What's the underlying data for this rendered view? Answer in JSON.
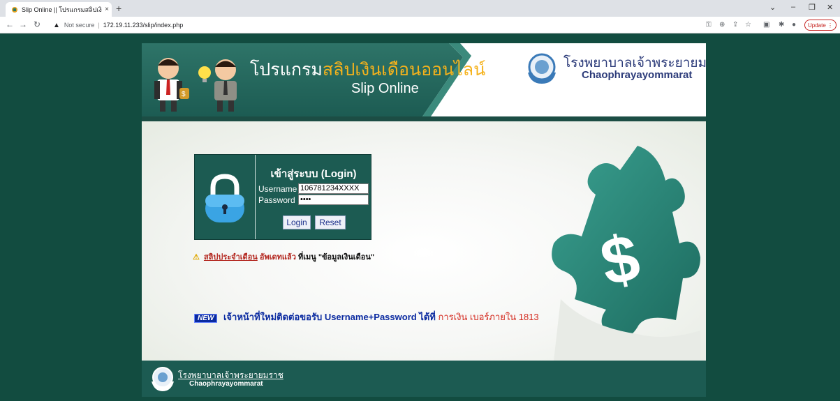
{
  "browser": {
    "tab_title": "Slip Online || โปรแกรมสลิปเงินเดือนออ",
    "tab_close": "×",
    "new_tab": "+",
    "security_label": "Not secure",
    "url": "172.19.11.233/slip/index.php",
    "update_label": "Update",
    "icons": [
      "back-icon",
      "forward-icon",
      "reload-icon",
      "warning-icon",
      "key-icon",
      "zoom-icon",
      "share-icon",
      "star-icon",
      "extensions-icon",
      "puzzle-icon",
      "profile-icon",
      "menu-icon"
    ]
  },
  "header": {
    "title_prefix": "โปรแกรม",
    "title_highlight": "สลิปเงินเดือนออนไลน์",
    "title_en": "Slip Online",
    "hospital_th": "โรงพยาบาลเจ้าพระยายมราช",
    "hospital_en": "Chaophrayayommarat"
  },
  "login": {
    "title": "เข้าสู่ระบบ (Login)",
    "username_label": "Username",
    "username_value": "106781234XXXX",
    "password_label": "Password",
    "password_value": "••••",
    "login_button": "Login",
    "reset_button": "Reset"
  },
  "notice": {
    "link_text": "สลิปประจำเดือน",
    "updated": "อัพเดทแล้ว",
    "rest": "ที่เมนู \"ข้อมูลเงินเดือน\""
  },
  "new_staff": {
    "badge": "NEW",
    "text_blue": "เจ้าหน้าที่ใหม่ติดต่อขอรับ Username+Password ได้ที่",
    "text_red": "การเงิน เบอร์ภายใน 1813"
  },
  "footer": {
    "hospital_th": "โรงพยาบาลเจ้าพระยายมราช",
    "hospital_en": "Chaophrayayommarat"
  },
  "colors": {
    "page_bg": "#124c40",
    "brand_teal": "#1c5b52",
    "highlight_orange": "#f5b21c",
    "hospital_blue": "#2d3c7a"
  }
}
